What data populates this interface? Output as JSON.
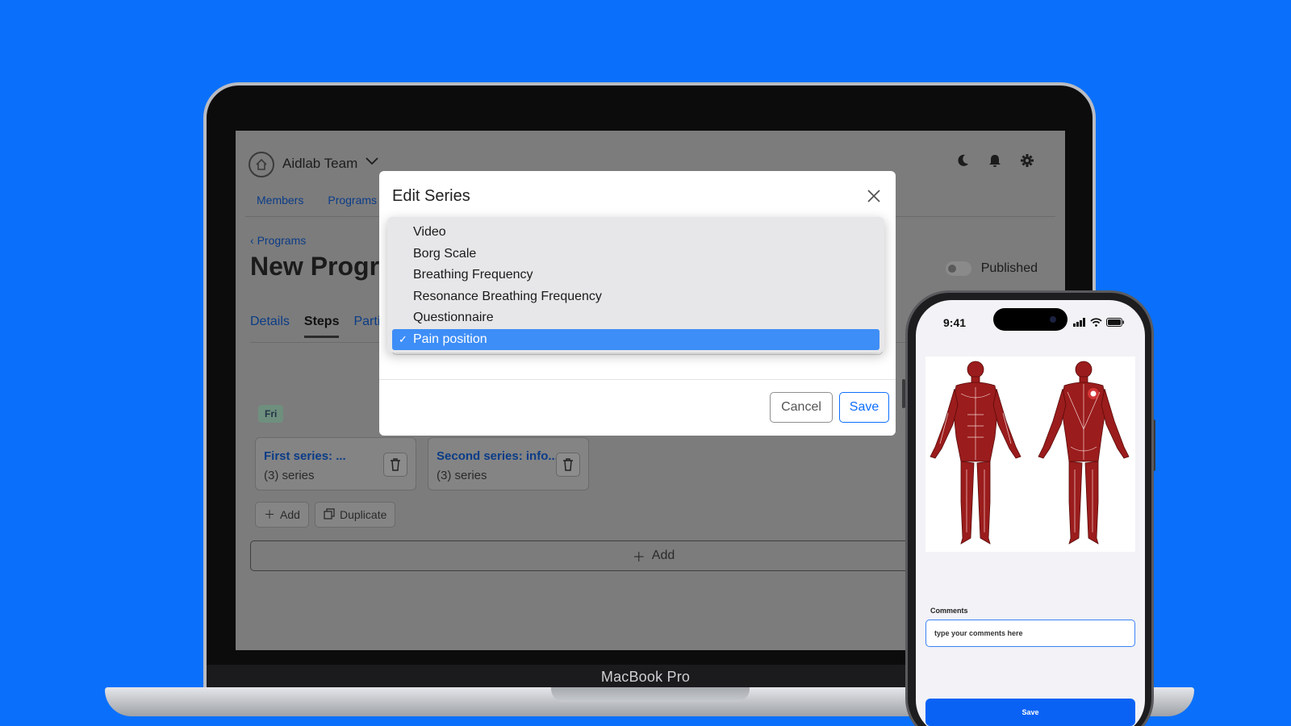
{
  "laptop": {
    "brand": "MacBook Pro"
  },
  "app": {
    "team_name": "Aidlab Team",
    "nav": [
      "Members",
      "Programs"
    ],
    "breadcrumb": "Programs",
    "page_title": "New Progr",
    "published_label": "Published",
    "tabs": [
      "Details",
      "Steps",
      "Parti"
    ],
    "active_tab": "Steps",
    "day_badge": "Fri",
    "series_cards": [
      {
        "title": "First series: ...",
        "count": "(3) series"
      },
      {
        "title": "Second series: info...",
        "count": "(3) series"
      }
    ],
    "add_label": "Add",
    "duplicate_label": "Duplicate",
    "add_wide_label": "Add"
  },
  "modal": {
    "title": "Edit Series",
    "options": [
      "Video",
      "Borg Scale",
      "Breathing Frequency",
      "Resonance Breathing Frequency",
      "Questionnaire",
      "Pain position"
    ],
    "selected_option": "Pain position",
    "check_mark": "✓",
    "cancel_label": "Cancel",
    "save_label": "Save"
  },
  "phone": {
    "time": "9:41",
    "comments_label": "Comments",
    "comments_placeholder": "type your comments here",
    "save_label": "Save",
    "pain_marker_color": "#ff4d4d",
    "muscle_color": "#9b1c1c"
  },
  "colors": {
    "background": "#0a70fb",
    "primary": "#0d6efd",
    "selected_option_bg": "#3e8ef7"
  }
}
